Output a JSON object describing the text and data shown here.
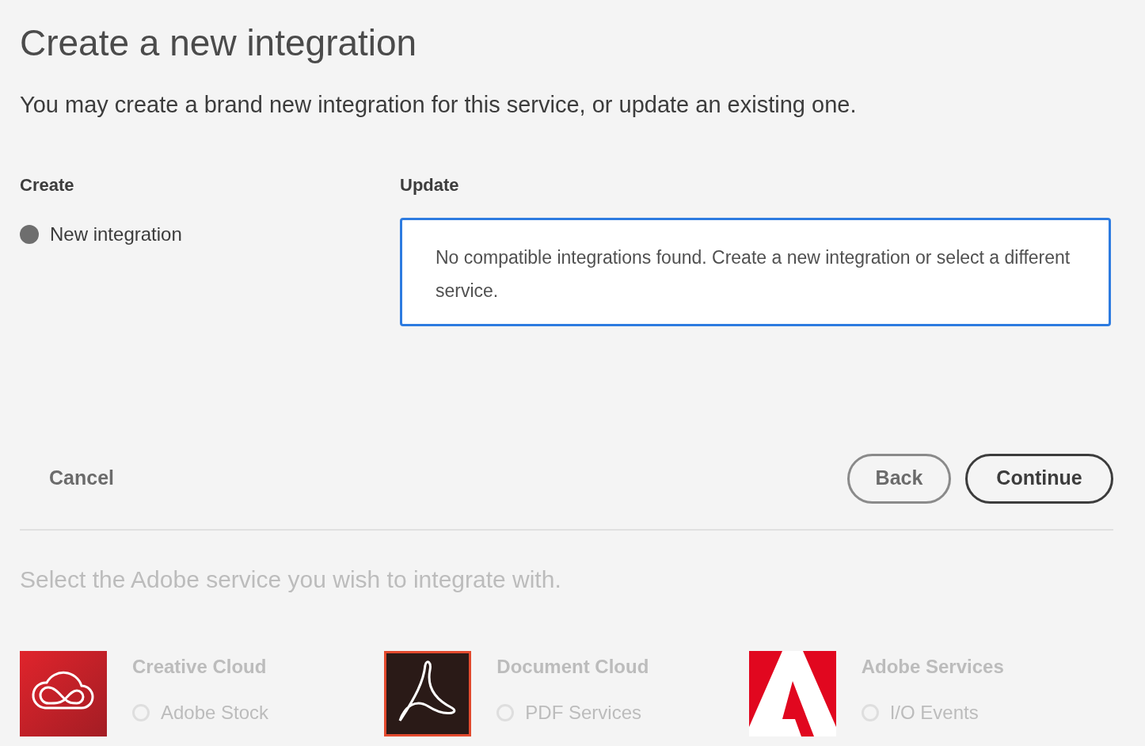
{
  "title": "Create a new integration",
  "subtitle": "You may create a brand new integration for this service, or update an existing one.",
  "create": {
    "heading": "Create",
    "options": [
      {
        "label": "New integration",
        "selected": true
      }
    ]
  },
  "update": {
    "heading": "Update",
    "message": "No compatible integrations found. Create a new integration or select a different service."
  },
  "actions": {
    "cancel": "Cancel",
    "back": "Back",
    "continue": "Continue"
  },
  "services_heading": "Select the Adobe service you wish to integrate with.",
  "services": [
    {
      "kind": "creative-cloud",
      "name": "Creative Cloud",
      "selected": false,
      "options": [
        {
          "label": "Adobe Stock",
          "selected": false
        }
      ]
    },
    {
      "kind": "document-cloud",
      "name": "Document Cloud",
      "selected": true,
      "options": [
        {
          "label": "PDF Services",
          "selected": false
        }
      ]
    },
    {
      "kind": "adobe",
      "name": "Adobe Services",
      "selected": false,
      "options": [
        {
          "label": "I/O Events",
          "selected": false
        }
      ]
    }
  ]
}
